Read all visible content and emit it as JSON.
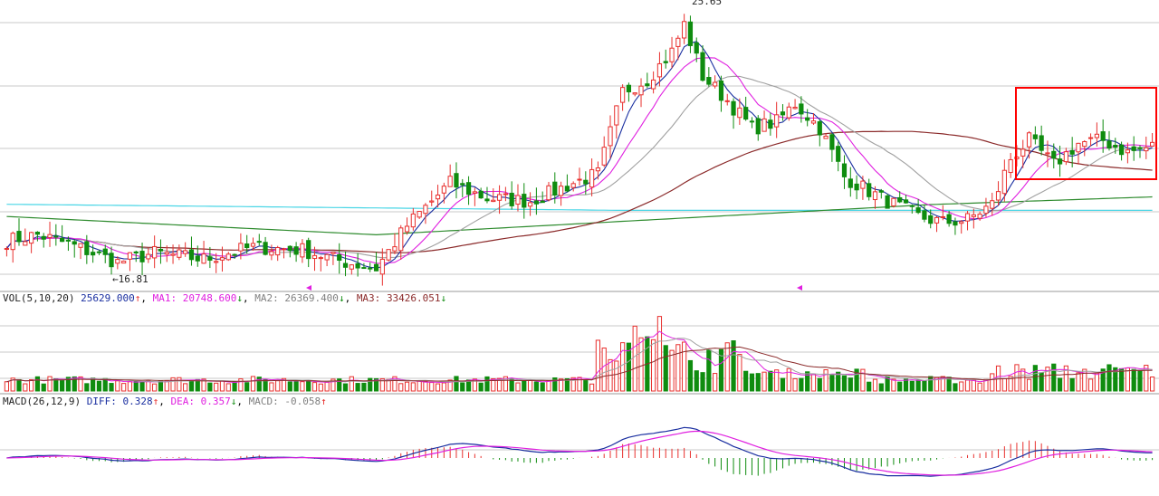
{
  "colors": {
    "up": "#e8302e",
    "down": "#0f8c0f",
    "diff_line": "#1a2fa0",
    "dea_line": "#e020e0",
    "ma1": "#e020e0",
    "ma2": "#a0a0a0",
    "ma3": "#8b2a2a",
    "ma_long_green": "#2e8b2e",
    "ma_cyan": "#4ad6e6",
    "highlight_box": "#ff0000",
    "grid": "#c8c8c8"
  },
  "price_panel": {
    "high_label": "25.65",
    "low_label": "16.81",
    "ylim": [
      16.5,
      26.0
    ]
  },
  "vol_panel": {
    "title": "VOL(5,10,20)",
    "vol_value": "25629.000",
    "vol_arrow": "↑",
    "ma1_label": "MA1:",
    "ma1_value": "20748.600",
    "ma1_arrow": "↓",
    "ma2_label": "MA2:",
    "ma2_value": "26369.400",
    "ma2_arrow": "↓",
    "ma3_label": "MA3:",
    "ma3_value": "33426.051",
    "ma3_arrow": "↓"
  },
  "macd_panel": {
    "title": "MACD(26,12,9)",
    "diff_label": "DIFF:",
    "diff_value": "0.328",
    "diff_arrow": "↑",
    "dea_label": "DEA:",
    "dea_value": "0.357",
    "dea_arrow": "↓",
    "macd_label": "MACD:",
    "macd_value": "-0.058",
    "macd_arrow": "↑"
  },
  "chart_data": {
    "type": "candlestick",
    "candles": 187,
    "anchors": [
      [
        0,
        18.1
      ],
      [
        5,
        18.3
      ],
      [
        10,
        18.0
      ],
      [
        18,
        17.4
      ],
      [
        24,
        17.7
      ],
      [
        32,
        17.5
      ],
      [
        40,
        17.9
      ],
      [
        48,
        17.8
      ],
      [
        55,
        17.4
      ],
      [
        60,
        17.2
      ],
      [
        65,
        18.6
      ],
      [
        72,
        20.0
      ],
      [
        78,
        19.5
      ],
      [
        85,
        19.4
      ],
      [
        92,
        20.0
      ],
      [
        96,
        20.3
      ],
      [
        100,
        23.0
      ],
      [
        104,
        23.4
      ],
      [
        108,
        24.3
      ],
      [
        110,
        25.2
      ],
      [
        113,
        23.5
      ],
      [
        117,
        22.7
      ],
      [
        121,
        21.8
      ],
      [
        125,
        22.0
      ],
      [
        128,
        22.6
      ],
      [
        132,
        21.8
      ],
      [
        136,
        20.2
      ],
      [
        142,
        19.5
      ],
      [
        148,
        18.9
      ],
      [
        152,
        18.7
      ],
      [
        156,
        18.8
      ],
      [
        160,
        19.3
      ],
      [
        163,
        20.8
      ],
      [
        166,
        21.4
      ],
      [
        170,
        20.6
      ],
      [
        174,
        21.3
      ],
      [
        178,
        21.4
      ],
      [
        182,
        21.0
      ],
      [
        186,
        21.2
      ]
    ],
    "volume_range": [
      0,
      100000
    ],
    "macd_range": [
      -0.9,
      1.2
    ]
  }
}
